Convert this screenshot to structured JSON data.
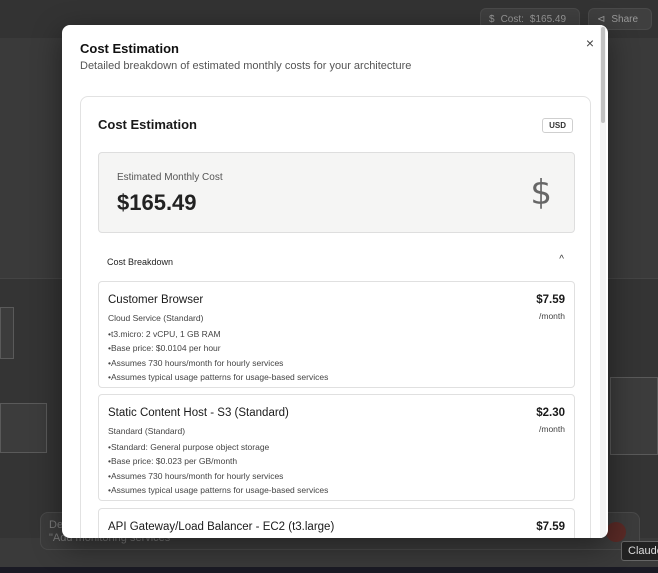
{
  "background": {
    "cost_pill": {
      "label": "Cost:",
      "value": "$165.49"
    },
    "share_label": "Share",
    "chat_placeholder": "De\n\"Add monitoring services\"",
    "tooltip": "Claude"
  },
  "modal": {
    "title": "Cost Estimation",
    "description": "Detailed breakdown of estimated monthly costs for your architecture",
    "close_glyph": "×",
    "card": {
      "title": "Cost Estimation",
      "currency": "USD",
      "estimated_label": "Estimated Monthly Cost",
      "estimated_value": "$165.49",
      "dollar_glyph": "$",
      "breakdown_label": "Cost Breakdown",
      "breakdown_toggle": "^",
      "items": [
        {
          "name": "Customer Browser",
          "price": "$7.59",
          "per": "/month",
          "type": "Cloud Service (Standard)",
          "details": [
            "t3.micro: 2 vCPU, 1 GB RAM",
            "Base price: $0.0104 per hour",
            "Assumes 730 hours/month for hourly services",
            "Assumes typical usage patterns for usage-based services"
          ]
        },
        {
          "name": "Static Content Host - S3 (Standard)",
          "price": "$2.30",
          "per": "/month",
          "type": "Standard (Standard)",
          "details": [
            "Standard: General purpose object storage",
            "Base price: $0.023 per GB/month",
            "Assumes 730 hours/month for hourly services",
            "Assumes typical usage patterns for usage-based services"
          ]
        },
        {
          "name": "API Gateway/Load Balancer - EC2 (t3.large)",
          "price": "$7.59"
        }
      ]
    }
  },
  "colors": {
    "overlay": "#2f2f2f",
    "modal_bg": "#ffffff",
    "estimate_bg": "#f5f5f4",
    "border": "#e0e0e0"
  }
}
